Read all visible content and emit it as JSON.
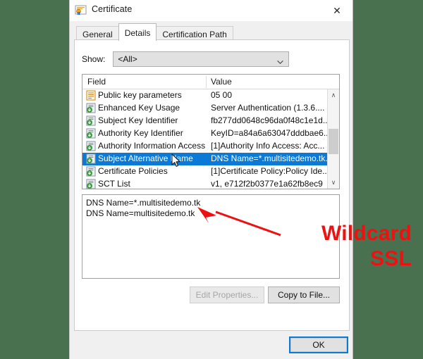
{
  "window": {
    "title": "Certificate",
    "icon": "certificate-icon",
    "close_label": "✕"
  },
  "tabs": [
    {
      "label": "General",
      "active": false
    },
    {
      "label": "Details",
      "active": true
    },
    {
      "label": "Certification Path",
      "active": false
    }
  ],
  "show": {
    "label": "Show:",
    "value": "<All>",
    "options": [
      "<All>"
    ]
  },
  "field_list": {
    "columns": [
      "Field",
      "Value"
    ],
    "rows": [
      {
        "field": "Public key parameters",
        "value": "05 00",
        "icon": "orange-document-icon",
        "selected": false
      },
      {
        "field": "Enhanced Key Usage",
        "value": "Server Authentication (1.3.6....",
        "icon": "extension-document-icon",
        "selected": false
      },
      {
        "field": "Subject Key Identifier",
        "value": "fb277dd0648c96da0f48c1e1d...",
        "icon": "extension-document-icon",
        "selected": false
      },
      {
        "field": "Authority Key Identifier",
        "value": "KeyID=a84a6a63047dddbae6...",
        "icon": "extension-document-icon",
        "selected": false
      },
      {
        "field": "Authority Information Access",
        "value": "[1]Authority Info Access: Acc...",
        "icon": "extension-document-icon",
        "selected": false
      },
      {
        "field": "Subject Alternative Name",
        "value": "DNS Name=*.multisitedemo.tk...",
        "icon": "extension-document-icon",
        "selected": true
      },
      {
        "field": "Certificate Policies",
        "value": "[1]Certificate Policy:Policy Ide...",
        "icon": "extension-document-icon",
        "selected": false
      },
      {
        "field": "SCT List",
        "value": "v1, e712f2b0377e1a62fb8ec9",
        "icon": "extension-document-icon",
        "selected": false
      }
    ],
    "scrollbar": {
      "up": "∧",
      "down": "∨"
    }
  },
  "detail": {
    "lines": [
      "DNS Name=*.multisitedemo.tk",
      "DNS Name=multisitedemo.tk"
    ]
  },
  "annotation": {
    "line1": "Wildcard",
    "line2": "SSL",
    "color": "#ee1111",
    "arrow": "red-arrow-icon"
  },
  "buttons": {
    "edit_properties": "Edit Properties...",
    "copy_to_file": "Copy to File...",
    "ok": "OK"
  },
  "colors": {
    "desktop_background": "#4a714f",
    "selection": "#0b7ad6",
    "dialog_background": "#f0f0f0"
  }
}
